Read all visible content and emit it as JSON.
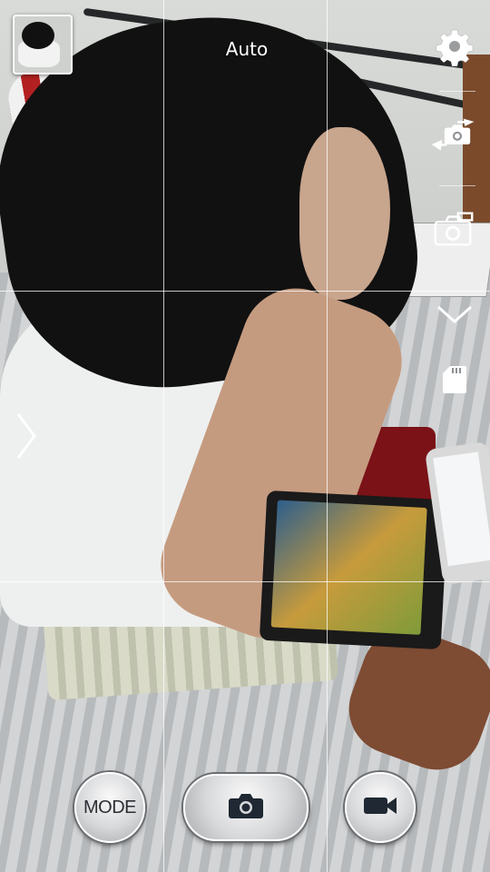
{
  "camera": {
    "scene_mode_label": "Auto",
    "mode_button_label": "MODE"
  },
  "icons": {
    "gallery_thumbnail": "gallery-thumbnail-icon",
    "settings": "gear-icon",
    "switch_camera": "switch-camera-icon",
    "shortcut_camera": "camera-shortcut-icon",
    "collapse": "chevron-down-icon",
    "storage": "sd-card-icon",
    "expand_panel": "chevron-right-icon",
    "shutter": "camera-icon",
    "record": "video-camera-icon"
  },
  "colors": {
    "overlay_text": "#ffffff",
    "button_icon": "#1f2833",
    "grid_line": "#ffffff"
  }
}
